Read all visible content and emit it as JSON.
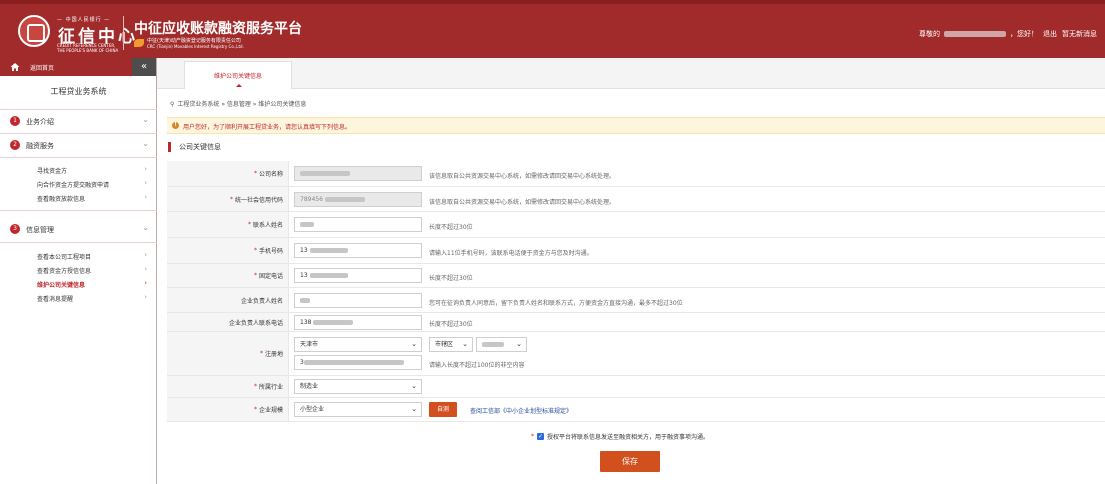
{
  "header": {
    "logo_top": "— 中国人民银行 —",
    "logo_cn": "征信中心",
    "logo_en_line1": "CREDIT REFERENCE CENTER,",
    "logo_en_line2": "THE PEOPLE'S BANK OF CHINA",
    "platform_title": "中征应收账款融资服务平台",
    "company_cn": "中征(天津)动产融资登记服务有限责任公司",
    "company_en": "CRC (Tianjin) Movables Interest Registry Co.,Ltd.",
    "greeting_prefix": "尊敬的",
    "greeting_suffix": "，您好！",
    "logout": "退出",
    "messages": "暂无新消息"
  },
  "sidebar": {
    "home": "返回首页",
    "collapse": "«",
    "system_title": "工程贷业务系统",
    "groups": [
      {
        "num": "1",
        "label": "业务介绍",
        "chevron": "⌄"
      },
      {
        "num": "2",
        "label": "融资服务",
        "chevron": "⌄"
      },
      {
        "num": "3",
        "label": "信息管理",
        "chevron": "⌄"
      }
    ],
    "finance_items": [
      {
        "label": "寻找资金方",
        "chevron": "›"
      },
      {
        "label": "向合作资金方提交融资申请",
        "chevron": "›"
      },
      {
        "label": "查看融资放款信息",
        "chevron": "›"
      }
    ],
    "info_items": [
      {
        "label": "查看本公司工程项目",
        "chevron": "›"
      },
      {
        "label": "查看资金方授信信息",
        "chevron": "›"
      },
      {
        "label": "维护公司关键信息",
        "chevron": "›"
      },
      {
        "label": "查看消息提醒",
        "chevron": "›"
      }
    ]
  },
  "tab": {
    "label": "维护公司关键信息"
  },
  "breadcrumb": "工程贷业务系统 » 信息管理 » 维护公司关键信息",
  "notice": "用户您好，为了顺利开展工程贷业务，请您认真填写下列信息。",
  "section_title": "公司关键信息",
  "form": {
    "company_name": {
      "label": "公司名称",
      "hint": "该信息取自公共资源交易中心系统，如需修改请回交易中心系统处理。"
    },
    "credit_code": {
      "label": "统一社会信用代码",
      "value": "789456",
      "hint": "该信息取自公共资源交易中心系统，如需修改请回交易中心系统处理。"
    },
    "contact_name": {
      "label": "联系人姓名",
      "hint": "长度不超过30位"
    },
    "mobile": {
      "label": "手机号码",
      "value": "13",
      "hint": "请输入11位手机号码，该联系电话便于资金方与您及时沟通。"
    },
    "landline": {
      "label": "固定电话",
      "value": "13",
      "hint": "长度不超过30位"
    },
    "legal_name": {
      "label": "企业负责人姓名",
      "hint": "您可在征询负责人同意后，留下负责人姓名和联系方式，方便资金方直接沟通，最多不超过30位"
    },
    "legal_phone": {
      "label": "企业负责人联系电话",
      "value": "138",
      "hint": "长度不超过30位"
    },
    "address": {
      "label": "注册地",
      "city": "天津市",
      "district": "市辖区",
      "street_prefix": "3",
      "hint": "请输入长度不超过100位的非空内容"
    },
    "industry": {
      "label": "所属行业",
      "value": "制造业"
    },
    "scale": {
      "label": "企业规模",
      "value": "小型企业",
      "self_test": "自测",
      "standard_link": "查阅工信部《中小企业划型标准规定》"
    }
  },
  "consent": "授权平台将联系信息发送至融资相关方，用于融资事项沟通。",
  "save": "保存",
  "required_mark": "*",
  "caret": "⌄",
  "checkmark": "✓",
  "notice_icon": "!",
  "pin_icon": "⚲"
}
